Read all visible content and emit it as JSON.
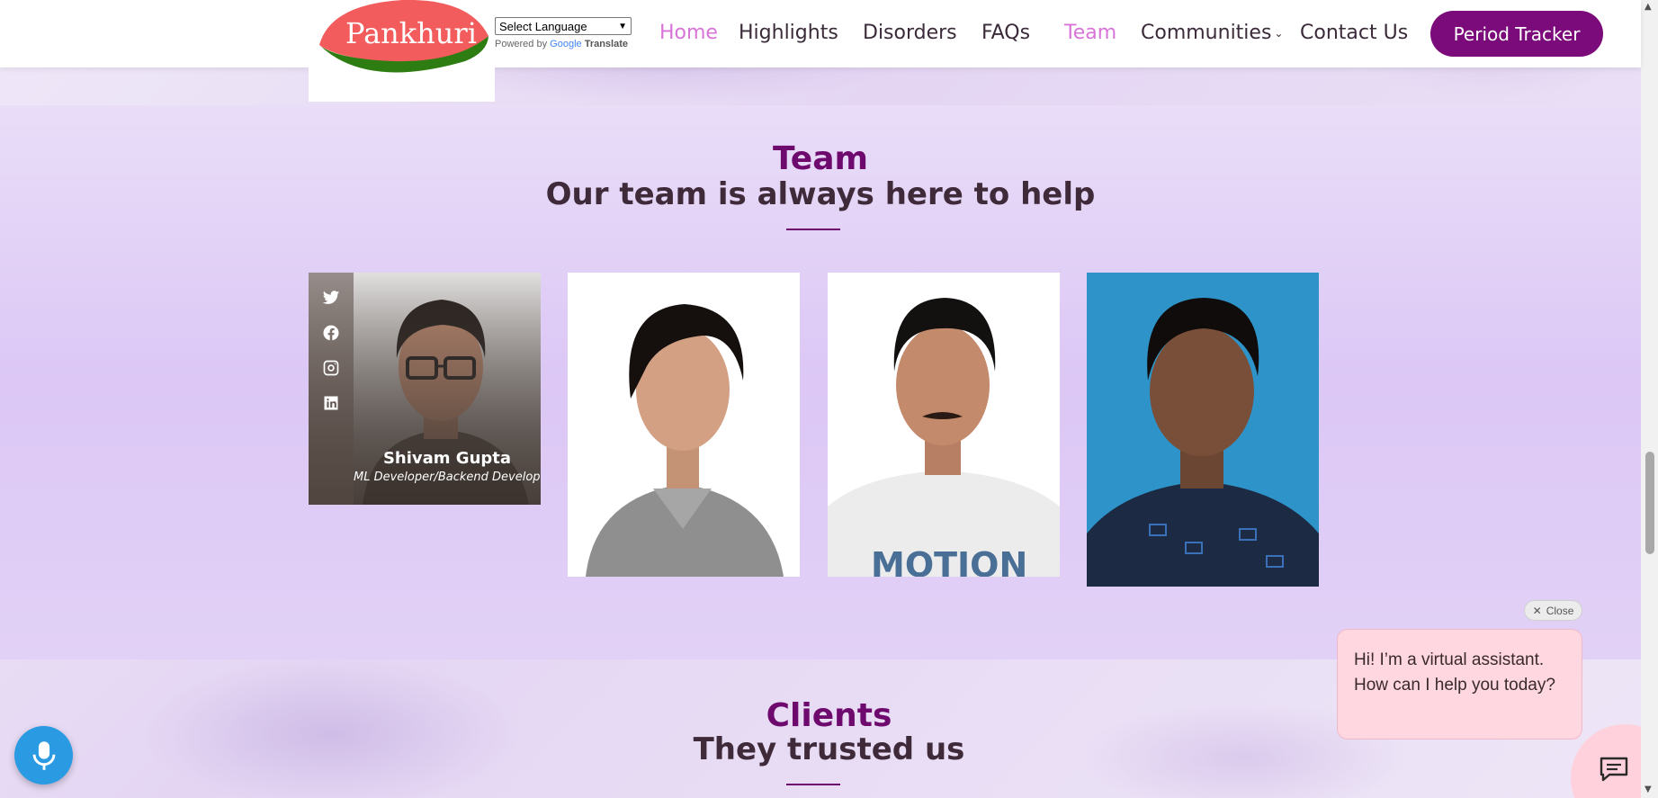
{
  "brand": {
    "logo_text": "Pankhuri"
  },
  "translate": {
    "select_label": "Select Language",
    "powered_by": "Powered by",
    "google": "Google",
    "translate": "Translate"
  },
  "nav": {
    "items": [
      {
        "label": "Home",
        "active": true
      },
      {
        "label": "Highlights",
        "active": false
      },
      {
        "label": "Disorders",
        "active": false
      },
      {
        "label": "FAQs",
        "active": false
      },
      {
        "label": "Team",
        "active": true
      },
      {
        "label": "Communities",
        "active": false
      },
      {
        "label": "Contact Us",
        "active": false
      }
    ],
    "cta": "Period Tracker"
  },
  "team": {
    "title": "Team",
    "subtitle": "Our team is always here to help",
    "members": [
      {
        "name": "Shivam Gupta",
        "role": "ML Developer/Backend Developer"
      },
      {
        "name": "",
        "role": ""
      },
      {
        "name": "",
        "role": ""
      },
      {
        "name": "",
        "role": ""
      }
    ],
    "shirt_text": "MOTION"
  },
  "clients": {
    "title": "Clients",
    "subtitle": "They trusted us"
  },
  "chat": {
    "close_label": "Close",
    "message": "Hi! I’m a virtual assistant. How can I help you today?"
  },
  "colors": {
    "accent": "#7b0a7b",
    "nav_active": "#d873d8",
    "mic": "#2a9be3",
    "chat_bubble": "#ffd7e0"
  }
}
